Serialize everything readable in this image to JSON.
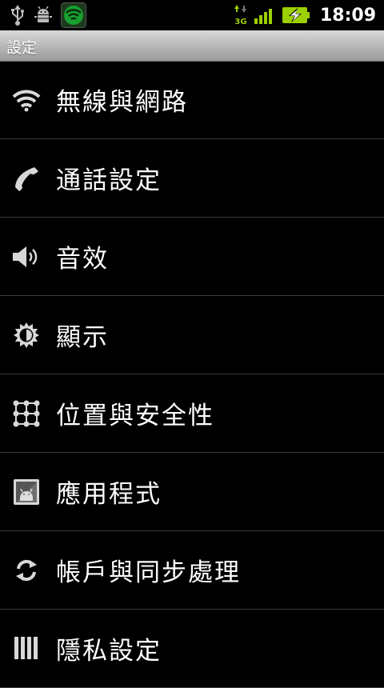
{
  "status_bar": {
    "time": "18:09",
    "network_type": "3G",
    "icons_left": [
      "usb-icon",
      "android-debug-icon",
      "lookout-shield-icon"
    ],
    "icons_right": [
      "data-3g-icon",
      "signal-icon",
      "battery-charging-icon"
    ]
  },
  "title_bar": {
    "title": "設定"
  },
  "settings": {
    "items": [
      {
        "label": "無線與網路",
        "icon": "wifi-icon"
      },
      {
        "label": "通話設定",
        "icon": "phone-icon"
      },
      {
        "label": "音效",
        "icon": "speaker-icon"
      },
      {
        "label": "顯示",
        "icon": "brightness-icon"
      },
      {
        "label": "位置與安全性",
        "icon": "pattern-lock-icon"
      },
      {
        "label": "應用程式",
        "icon": "applications-icon"
      },
      {
        "label": "帳戶與同步處理",
        "icon": "sync-icon"
      },
      {
        "label": "隱私設定",
        "icon": "privacy-icon"
      }
    ]
  },
  "colors": {
    "background": "#000000",
    "accent_green": "#9ccf00",
    "divider": "#3a3a3a"
  }
}
